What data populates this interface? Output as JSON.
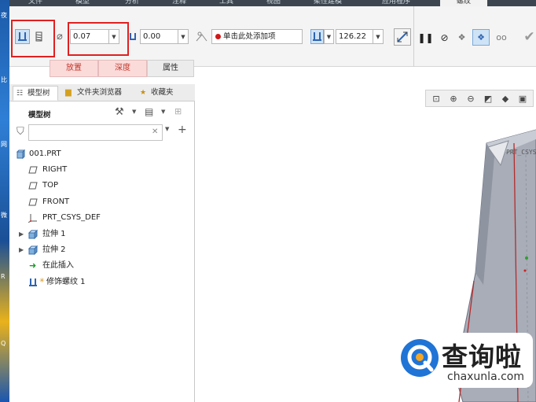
{
  "desktop": {
    "glyphs": [
      "夜",
      "比",
      "网",
      "微",
      "R",
      "Q"
    ]
  },
  "ribbon": {
    "tabs": [
      "文件",
      "模型",
      "分析",
      "注释",
      "工具",
      "视图",
      "柔性建模",
      "应用程序",
      "螺纹"
    ],
    "active_tab": "螺纹"
  },
  "dashboard": {
    "diameter_value": "0.07",
    "depth_value": "0.00",
    "reference_placeholder": "单击此处添加项",
    "length_value": "126.22",
    "tabs": [
      "放置",
      "深度",
      "属性"
    ]
  },
  "navigator": {
    "tabs": [
      "模型树",
      "文件夹浏览器",
      "收藏夹"
    ],
    "title": "模型树",
    "search_placeholder": "",
    "tree": [
      {
        "label": "001.PRT",
        "icon": "part-icon",
        "expandable": false
      },
      {
        "label": "RIGHT",
        "icon": "datum-plane-icon",
        "expandable": false
      },
      {
        "label": "TOP",
        "icon": "datum-plane-icon",
        "expandable": false
      },
      {
        "label": "FRONT",
        "icon": "datum-plane-icon",
        "expandable": false
      },
      {
        "label": "PRT_CSYS_DEF",
        "icon": "csys-icon",
        "expandable": false
      },
      {
        "label": "拉伸 1",
        "icon": "extrude-icon",
        "expandable": true
      },
      {
        "label": "拉伸 2",
        "icon": "extrude-icon",
        "expandable": true
      },
      {
        "label": "在此插入",
        "icon": "insert-arrow-icon",
        "expandable": false
      },
      {
        "label": "修饰螺纹 1",
        "icon": "cosmetic-thread-icon",
        "expandable": false
      }
    ]
  },
  "graphics": {
    "csys_label": "PRT_CSYS"
  },
  "watermark": {
    "cn": "查询啦",
    "en": "chaxunla.com"
  },
  "colors": {
    "accent_red": "#e02020",
    "ribbon_dark": "#3d4650",
    "pressed_blue": "#cfe3f6",
    "model_gray": "#a9aeb8"
  }
}
